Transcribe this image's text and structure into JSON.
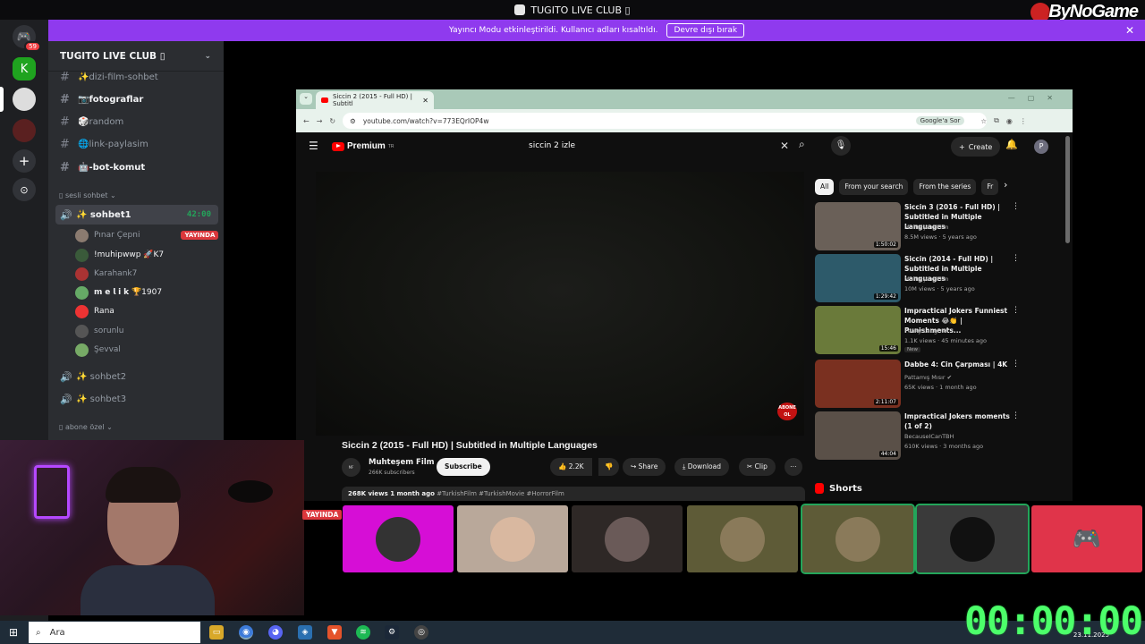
{
  "window_title": "TUGITO LIVE CLUB ▯",
  "brand": "ByNoGame",
  "streamer_mode": {
    "message": "Yayıncı Modu etkinleştirildi. Kullanıcı adları kısaltıldı.",
    "button": "Devre dışı bırak",
    "close": "✕"
  },
  "rail": {
    "badge": "59"
  },
  "server": {
    "name": "TUGITO LIVE CLUB ▯",
    "text_channels": [
      {
        "name": "✨dizi-film-sohbet"
      },
      {
        "name": "📷fotograflar"
      },
      {
        "name": "🎲random"
      },
      {
        "name": "🌐link-paylasim"
      },
      {
        "name": "🤖-bot-komut"
      }
    ],
    "voice_category": "▯ sesli sohbet ⌄",
    "voice_channels": [
      {
        "name": "✨ sohbet1",
        "time": "42:00"
      },
      {
        "name": "✨ sohbet2"
      },
      {
        "name": "✨ sohbet3"
      }
    ],
    "voice_users": [
      {
        "name": "Pınar Çepni",
        "badge": "YAYINDA",
        "color": "#8b7b70"
      },
      {
        "name": "!muhipwwp 🚀K7",
        "color": "#3a5a3a"
      },
      {
        "name": "Karahank7",
        "color": "#a33"
      },
      {
        "name": "𝗺 𝗲 𝗹 𝗶 𝗸 🏆1907",
        "color": "#6a6"
      },
      {
        "name": "Rana",
        "color": "#e33"
      },
      {
        "name": "sorunlu",
        "color": "#555"
      },
      {
        "name": "Şevval",
        "color": "#7a6"
      }
    ],
    "other_category": "▯ abone özel ⌄"
  },
  "browser": {
    "tab_title": "Siccin 2 (2015 - Full HD) | Subtitl",
    "url": "youtube.com/watch?v=773EQrIOP4w",
    "google_sor": "Google'a Sor"
  },
  "youtube": {
    "logo": "Premium",
    "logo_tr": "TR",
    "search": "siccin 2 izle",
    "create": "Create",
    "avatar": "P",
    "abone": "ABONE OL",
    "video_title": "Siccin 2 (2015 - Full HD) | Subtitled in Multiple Languages",
    "channel": "Muhteşem Film",
    "subscribers": "266K subscribers",
    "subscribe": "Subscribe",
    "likes": "👍 2.2K",
    "dislike": "👎",
    "share": "↪ Share",
    "download": "⤓ Download",
    "clip": "✂ Clip",
    "more": "⋯",
    "desc_stats": "268K views  1 month ago",
    "desc_tags": " #TurkishFilm #TurkishMovie #HorrorFilm",
    "chips": [
      "All",
      "From your search",
      "From the series",
      "Fr"
    ],
    "shorts": "Shorts",
    "recommendations": [
      {
        "title": "Siccin 3 (2016 - Full HD) | Subtitled in Multiple Languages",
        "channel": "Muhteşem Film",
        "views": "8.5M views · 5 years ago",
        "duration": "1:50:02",
        "color": "#6a6058"
      },
      {
        "title": "Siccin (2014 - Full HD) | Subtitled in Multiple Languages",
        "channel": "Muhteşem Film",
        "views": "10M views · 5 years ago",
        "duration": "1:29:42",
        "color": "#2d5a6a"
      },
      {
        "title": "Impractical Jokers Funniest Moments 😂👏 | Punishments...",
        "channel": "Peaky Laughter",
        "views": "1.1K views · 45 minutes ago",
        "duration": "15:46",
        "color": "#6a7a3a",
        "new": "New"
      },
      {
        "title": "Dabbe 4: Cin Çarpması | 4K",
        "channel": "Pattamış Mısır ✔",
        "views": "65K views · 1 month ago",
        "duration": "2:11:07",
        "color": "#7a3020"
      },
      {
        "title": "Impractical Jokers moments (1 of 2)",
        "channel": "BecauseICanTBH",
        "views": "610K views · 3 months ago",
        "duration": "44:04",
        "color": "#5a5048"
      }
    ]
  },
  "cam_badge": "YAYINDA",
  "tiles": [
    {
      "color": "#d60ed6",
      "ring": "#333"
    },
    {
      "color": "#b9a89a",
      "ring": "#d9b8a0"
    },
    {
      "color": "#2e2826",
      "ring": "#6a5a58"
    },
    {
      "color": "#5e5b37",
      "ring": "#8a7a5a"
    },
    {
      "color": "#5e5b37",
      "ring": "#8a7a5a",
      "speaking": true
    },
    {
      "color": "#3a3a3a",
      "ring": "#111",
      "speaking": true
    },
    {
      "color": "#e0344a",
      "ring": "#e0344a",
      "discord": true
    }
  ],
  "taskbar": {
    "search_placeholder": "Ara",
    "date": "23.11.2025"
  },
  "stream_timer": "00:00:00"
}
